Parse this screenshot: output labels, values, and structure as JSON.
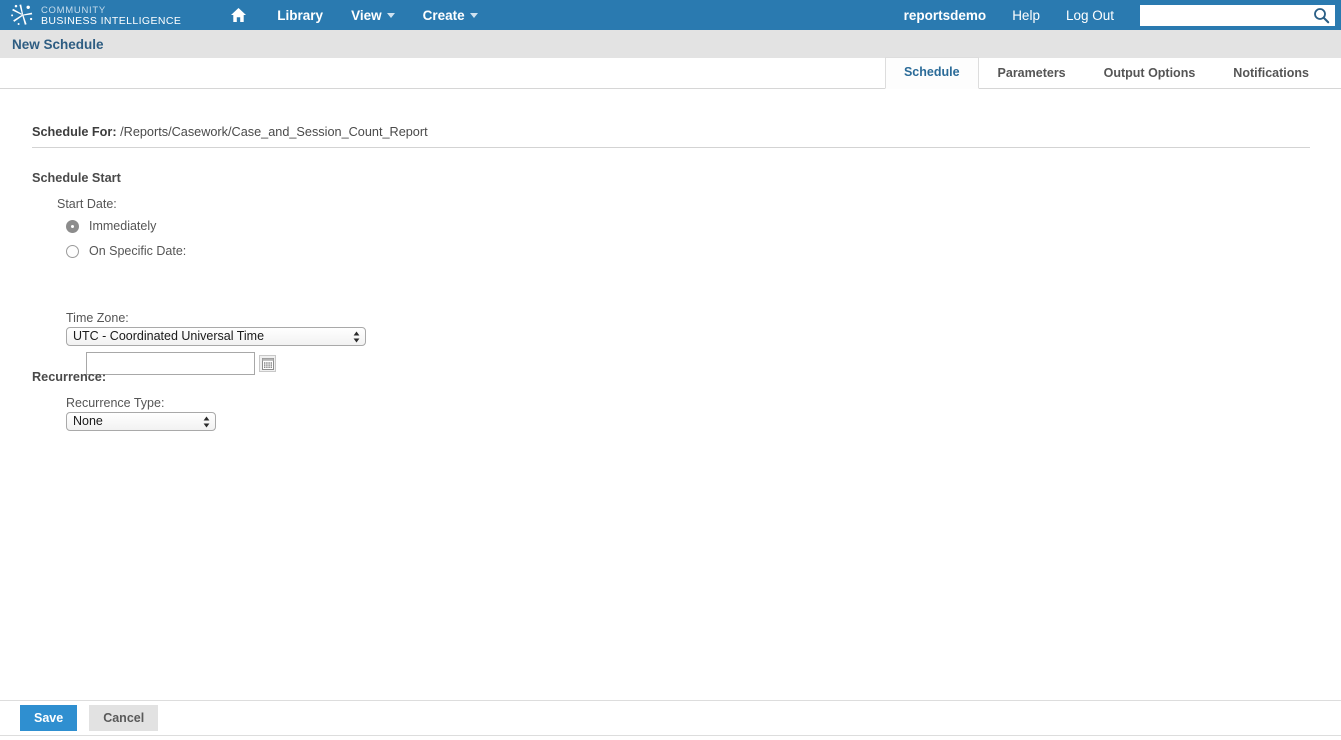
{
  "header": {
    "brand_line1": "COMMUNITY",
    "brand_line2": "BUSINESS INTELLIGENCE",
    "brand_icon": "starburst-logo-icon",
    "home_icon": "home-icon",
    "nav": [
      {
        "label": "Library",
        "has_caret": false
      },
      {
        "label": "View",
        "has_caret": true
      },
      {
        "label": "Create",
        "has_caret": true
      }
    ],
    "user": "reportsdemo",
    "help_label": "Help",
    "logout_label": "Log Out",
    "search": {
      "value": "",
      "placeholder": "",
      "icon": "search-icon"
    },
    "bg_color": "#2a7ab0"
  },
  "titlebar": {
    "title": "New Schedule",
    "bg_color": "#e3e3e3",
    "text_color": "#2e5d82"
  },
  "tabs": [
    {
      "label": "Schedule",
      "active": true
    },
    {
      "label": "Parameters",
      "active": false
    },
    {
      "label": "Output Options",
      "active": false
    },
    {
      "label": "Notifications",
      "active": false
    }
  ],
  "main": {
    "schedule_for_label": "Schedule For:",
    "schedule_for_path": "/Reports/Casework/Case_and_Session_Count_Report",
    "schedule_start_heading": "Schedule Start",
    "start_date_label": "Start Date:",
    "radio_immediately": {
      "label": "Immediately",
      "checked": true
    },
    "radio_specific_date": {
      "label": "On Specific Date:",
      "checked": false
    },
    "date_input": {
      "value": "",
      "placeholder": ""
    },
    "calendar_icon": "calendar-icon",
    "time_zone_label": "Time Zone:",
    "time_zone_value": "UTC - Coordinated Universal Time",
    "time_zone_options": [
      "UTC - Coordinated Universal Time"
    ],
    "recurrence_heading": "Recurrence:",
    "recurrence_type_label": "Recurrence Type:",
    "recurrence_type_value": "None",
    "recurrence_type_options": [
      "None"
    ]
  },
  "footer": {
    "save_label": "Save",
    "cancel_label": "Cancel",
    "save_color": "#2f8fd0",
    "cancel_color": "#e2e2e2"
  }
}
